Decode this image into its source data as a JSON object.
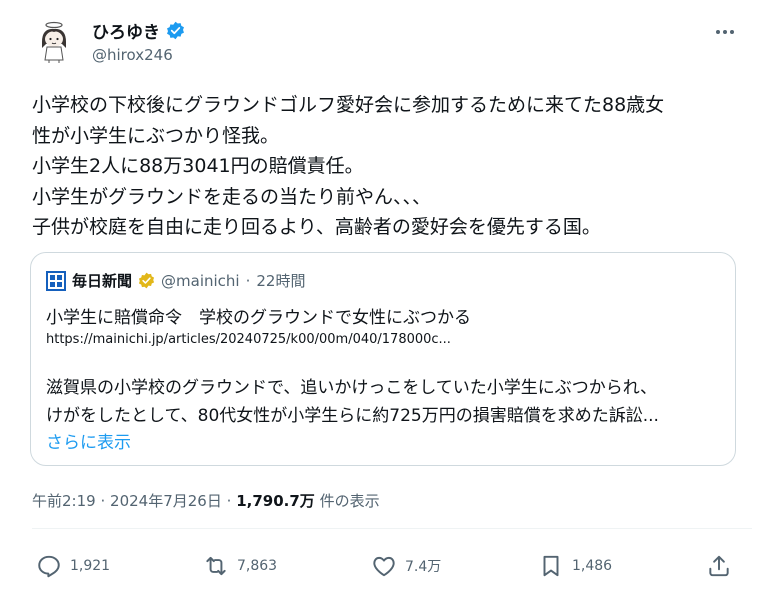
{
  "author": {
    "display_name": "ひろゆき",
    "handle": "@hirox246"
  },
  "tweet": {
    "lines": [
      "小学校の下校後にグラウンドゴルフ愛好会に参加するために来てた88歳女",
      "性が小学生にぶつかり怪我。",
      "小学生2人に88万3041円の賠償責任。",
      "小学生がグラウンドを走るの当たり前やん、、、",
      "子供が校庭を自由に走り回るより、高齢者の愛好会を優先する国。"
    ]
  },
  "quote": {
    "name": "毎日新聞",
    "handle": "@mainichi",
    "separator": "·",
    "time": "22時間",
    "title": "小学生に賠償命令　学校のグラウンドで女性にぶつかる",
    "link": "https://mainichi.jp/articles/20240725/k00/00m/040/178000c...",
    "body_lines": [
      "滋賀県の小学校のグラウンドで、追いかけっこをしていた小学生にぶつかられ、",
      "けがをしたとして、80代女性が小学生らに約725万円の損害賠償を求めた訴訟..."
    ],
    "show_more": "さらに表示"
  },
  "meta": {
    "time": "午前2:19",
    "separator": "·",
    "date": "2024年7月26日",
    "views": "1,790.7万",
    "views_label": "件の表示"
  },
  "actions": {
    "reply_count": "1,921",
    "retweet_count": "7,863",
    "like_count": "7.4万",
    "bookmark_count": "1,486"
  },
  "colors": {
    "text": "#0f1419",
    "secondary": "#536471",
    "link": "#1d9bf0",
    "verified_blue": "#1d9bf0",
    "verified_gold": "#e2b719",
    "border": "#cfd9de"
  },
  "icons": {
    "avatar": "cartoon-girl-avatar",
    "verified": "verified-badge-icon",
    "more": "more-horizontal-icon",
    "reply": "reply-icon",
    "retweet": "retweet-icon",
    "like": "heart-icon",
    "bookmark": "bookmark-icon",
    "share": "share-icon"
  }
}
